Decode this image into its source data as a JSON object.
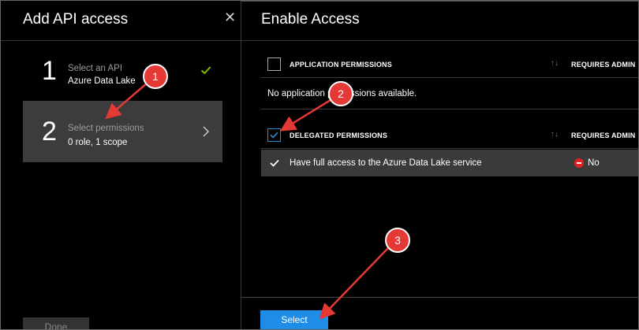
{
  "left_blade": {
    "title": "Add API access",
    "steps": [
      {
        "number": "1",
        "label": "Select an API",
        "value": "Azure Data Lake",
        "status": "check-icon"
      },
      {
        "number": "2",
        "label": "Select permissions",
        "value": "0 role, 1 scope",
        "status": "chevron-right-icon"
      }
    ],
    "done_label": "Done"
  },
  "right_blade": {
    "title": "Enable Access",
    "application_header": "APPLICATION PERMISSIONS",
    "requires_admin_header": "REQUIRES ADMIN",
    "no_app_text": "No application permissions available.",
    "delegated_header": "DELEGATED PERMISSIONS",
    "permissions": [
      {
        "name": "Have full access to the Azure Data Lake service",
        "requires_admin": "No",
        "checked": true
      }
    ],
    "select_label": "Select"
  },
  "callouts": [
    "1",
    "2",
    "3"
  ],
  "colors": {
    "accent": "#1f8ce6",
    "check_green": "#7fba00",
    "callout_red": "#e53935",
    "selected_row": "#3c3c3c"
  }
}
